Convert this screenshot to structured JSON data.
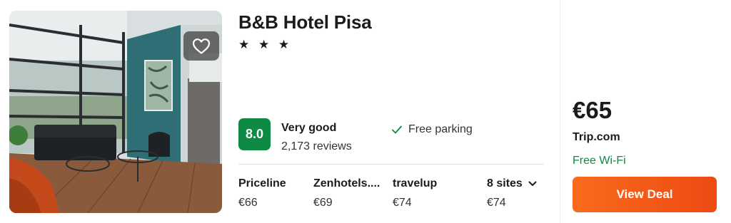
{
  "hotel": {
    "name": "B&B Hotel Pisa",
    "stars": "★ ★ ★",
    "rating": {
      "score": "8.0",
      "label": "Very good",
      "reviews": "2,173 reviews"
    },
    "amenity": "Free parking"
  },
  "providers": [
    {
      "name": "Priceline",
      "price": "€66"
    },
    {
      "name": "Zenhotels....",
      "price": "€69"
    },
    {
      "name": "travelup",
      "price": "€74"
    },
    {
      "name": "8 sites",
      "price": "€74"
    }
  ],
  "best_deal": {
    "price": "€65",
    "site": "Trip.com",
    "perk": "Free Wi-Fi",
    "button_label": "View Deal"
  },
  "colors": {
    "score_badge": "#0e8a45",
    "deal_button": "#f4601a",
    "perk_text": "#0e8a45"
  },
  "icons": {
    "favorite": "heart-icon",
    "amenity": "check-icon",
    "sites_toggle": "chevron-down-icon"
  }
}
